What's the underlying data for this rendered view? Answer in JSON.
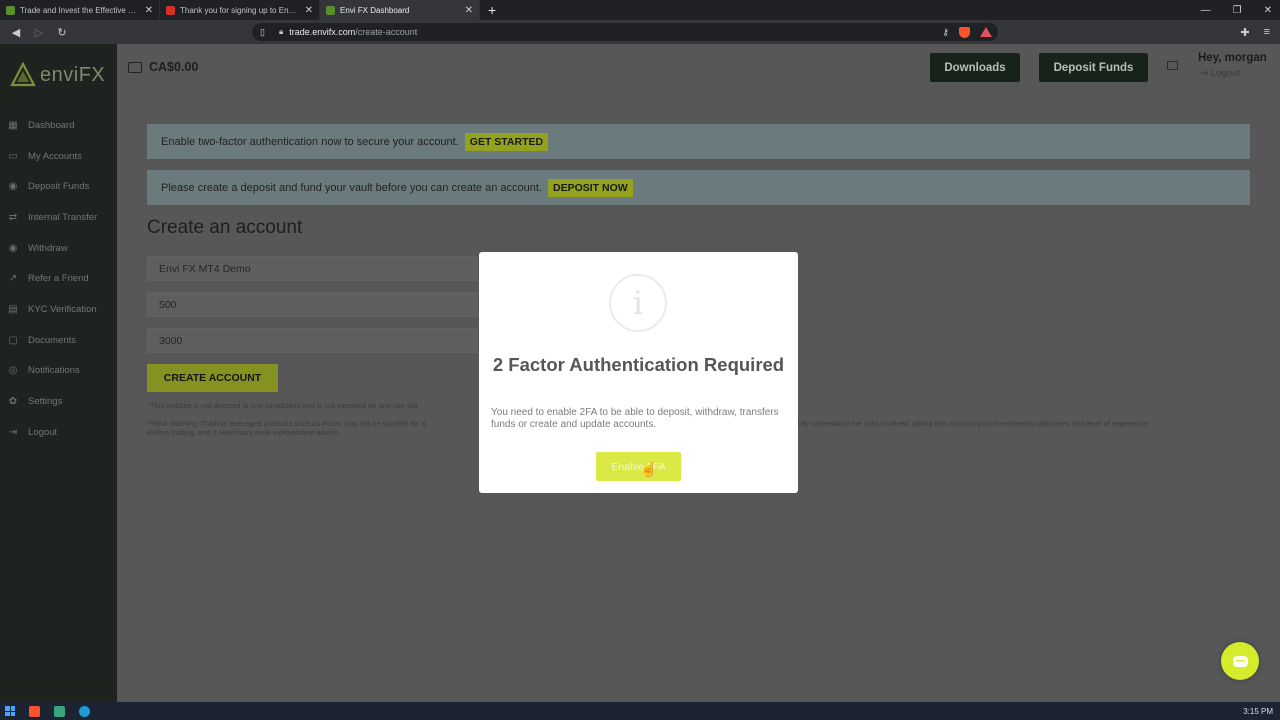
{
  "browser": {
    "tabs": [
      {
        "title": "Trade and Invest the Effective Way | E",
        "color": "#5b8f2e",
        "active": false
      },
      {
        "title": "Thank you for signing up to Envi FX -",
        "color": "#d93025",
        "active": false
      },
      {
        "title": "Envi FX Dashboard",
        "color": "#5b8f2e",
        "active": true
      }
    ],
    "new_tab_icon": "+",
    "url_domain": "trade.envifx.com",
    "url_path": "/create-account"
  },
  "sidebar": {
    "logo_text": "enviFX",
    "items": [
      {
        "label": "Dashboard",
        "icon": "grid-icon",
        "glyph": "▦"
      },
      {
        "label": "My Accounts",
        "icon": "wallet-icon",
        "glyph": "▭"
      },
      {
        "label": "Deposit Funds",
        "icon": "dollar-icon",
        "glyph": "◉"
      },
      {
        "label": "Internal Transfer",
        "icon": "transfer-icon",
        "glyph": "⇄"
      },
      {
        "label": "Withdraw",
        "icon": "withdraw-icon",
        "glyph": "◉"
      },
      {
        "label": "Refer a Friend",
        "icon": "share-icon",
        "glyph": "↗"
      },
      {
        "label": "KYC Verification",
        "icon": "id-card-icon",
        "glyph": "▤"
      },
      {
        "label": "Documents",
        "icon": "document-icon",
        "glyph": "▢"
      },
      {
        "label": "Notifications",
        "icon": "bell-icon",
        "glyph": "◎"
      },
      {
        "label": "Settings",
        "icon": "gear-icon",
        "glyph": "✿"
      },
      {
        "label": "Logout",
        "icon": "logout-icon",
        "glyph": "⇥"
      }
    ]
  },
  "header": {
    "balance": "CA$0.00",
    "downloads_label": "Downloads",
    "deposit_label": "Deposit Funds",
    "greeting": "Hey, morgan",
    "logout_label": "Logout"
  },
  "banners": {
    "twofa_text": "Enable two-factor authentication now to secure your account.",
    "twofa_cta": "GET STARTED",
    "deposit_text": "Please create a deposit and fund your vault before you can create an account.",
    "deposit_cta": "DEPOSIT NOW"
  },
  "form": {
    "heading": "Create an account",
    "account_type": "Envi FX MT4 Demo",
    "leverage": "500",
    "amount": "3000",
    "submit_label": "CREATE ACCOUNT",
    "disclaimer1": "*This website is not directed at any jurisdiction and is not intended for any use tha",
    "disclaimer2a": "**Risk Warning: Trading leveraged products such as Forex may not be suitable for a",
    "disclaimer2b": "Before trading, and if necessary seek independent advice.",
    "disclaimer2c": "ully understand the risks involved, taking into account your investments objectives and level of experience."
  },
  "modal": {
    "icon": "i",
    "title": "2 Factor Authentication Required",
    "body": "You need to enable 2FA to be able to deposit, withdraw, transfers funds or create and update accounts.",
    "button": "Enable 2FA"
  },
  "taskbar": {
    "time": "3:15 PM"
  },
  "colors": {
    "accent": "#d4ec2c",
    "sidebar_bg": "#1d2420",
    "overlay_bg": "#575757"
  }
}
